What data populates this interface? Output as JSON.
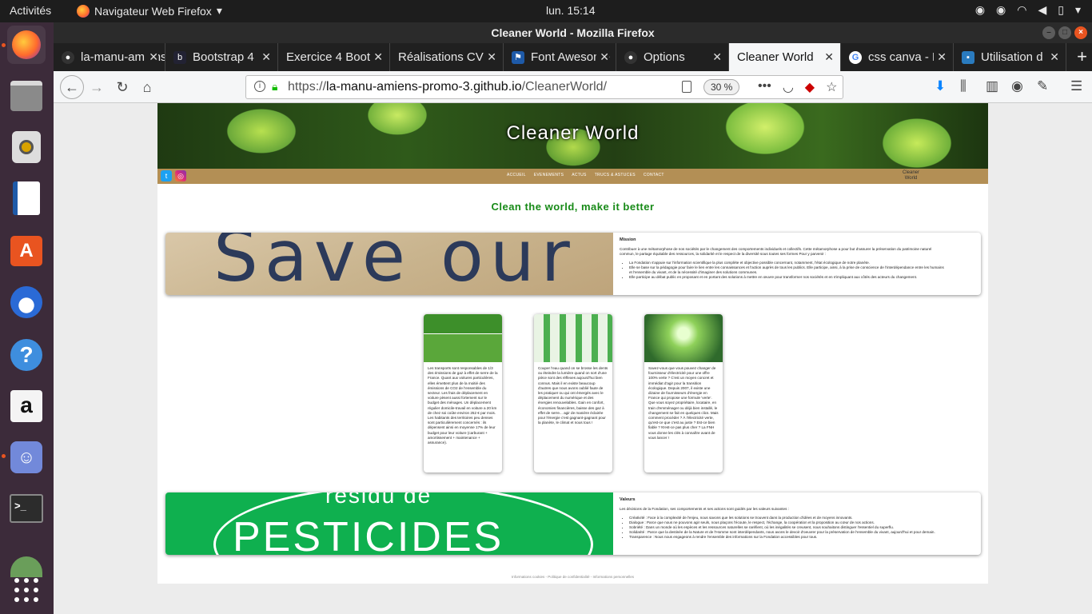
{
  "system": {
    "activities": "Activités",
    "app_name": "Navigateur Web Firefox",
    "clock": "lun. 15:14"
  },
  "window": {
    "title": "Cleaner World - Mozilla Firefox"
  },
  "tabs": [
    {
      "label": "la-manu-amiens",
      "icon": "github-icon"
    },
    {
      "label": "Bootstrap 4",
      "icon": "bootstrap-icon"
    },
    {
      "label": "Exercice 4 Boot",
      "icon": "none"
    },
    {
      "label": "Réalisations CV",
      "icon": "none"
    },
    {
      "label": "Font Awesome",
      "icon": "flag-icon"
    },
    {
      "label": "Options",
      "icon": "github-icon"
    },
    {
      "label": "Cleaner World",
      "icon": "none"
    },
    {
      "label": "css canva - R",
      "icon": "google-icon"
    },
    {
      "label": "Utilisation d",
      "icon": "page-icon"
    }
  ],
  "urlbar": {
    "url_prefix": "https://",
    "url_host": "la-manu-amiens-promo-3.github.io",
    "url_path": "/CleanerWorld/",
    "zoom": "30 %"
  },
  "site": {
    "title": "Cleaner World",
    "menu": [
      "ACCUEIL",
      "EVENEMENTS",
      "ACTUS",
      "TRUCS & ASTUCES",
      "CONTACT"
    ],
    "logo_line1": "Cleaner",
    "logo_line2": "World",
    "slogan": "Clean the world, make it better",
    "mission": {
      "heading": "Mission",
      "image_word": "Save our",
      "intro": "Contribuer à une métamorphose de nos sociétés par le changement des comportements individuels et collectifs. Cette métamorphose a pour but d'assurer la préservation du patrimoine naturel commun, le partage équitable des ressources, la solidarité et le respect de la diversité sous toutes ses formes Pour y parvenir :",
      "items": [
        "La Fondation s'appuie sur l'information scientifique la plus complète et objective possible concernant, notamment, l'état écologique de notre planète.",
        "Elle se base sur la pédagogie pour faire le lien entre les connaissances et l'action auprès de tous les publics. Elle participe, ainsi, à la prise de conscience de l'interdépendance entre les humains et l'ensemble du vivant, et de la nécessité d'imaginer des solutions communes.",
        "Elle participe au débat public en proposant et en portant des solutions à mettre en œuvre pour transformer nos sociétés et en s'impliquant aux côtés des acteurs du changement."
      ]
    },
    "cards": [
      {
        "text": "Les transports sont responsables de 1/3 des émissions de gaz à effet de serre de la France. Quant aux voitures particulières, elles émettent plus de la moitié des émissions de CO2 de l'ensemble du secteur. Les frais de déplacement en voiture pèsent aussi fortement sur le budget des ménages. Un déplacement régulier domicile-travail en voiture a 20 km de chez soi coûte environ 252 € par mois. Les habitants des territoires peu denses sont particulièrement concernés : ils dépensent ainsi en moyenne 17% de leur budget pour leur voiture (carburant + amortissement + maintenance + assurance)."
      },
      {
        "text": "Couper l'eau quand on se brosse les dents ou éteindre la lumière quand on sort d'une pièce sont des réflexes aujourd'hui bien connus. Mais il en existe beaucoup d'autres que nous avons oublié faute de les pratiquer ou qui ont émergés avec le déplacement du numérique et des énergies renouvelables. Gain en confort, économies financières, baisse des gaz à effet de serre... agir de manière éclairée pour l'énergie c'est gagnant-gagnant pour la planète, le climat et nous tous !"
      },
      {
        "text": "Savez-vous que vous pouvez changer de fournisseur d'électricité pour une offre 100% verte ? C'est un moyen concret et immédiat d'agir pour la transition écologique. Depuis 2007, il existe une dizaine de fournisseurs d'énergie en France qui propose une formule 'verte'. Que vous soyez propriétaire, locataire, en train d'emménager ou déjà bien installé, le changement se fait en quelques clics. Mais comment procéder ? À l'électricité verte, qu'est-ce que c'est au juste ? Est-ce bien fiable ? N'est-ce pas plus cher ? La FNH vous donne les clés à connaître avant de vous lancer !"
      }
    ],
    "valeurs": {
      "heading": "Valeurs",
      "image_word1": "résidu de",
      "image_word2": "PESTICIDES",
      "intro": "Les décisions de la Fondation, ses comportements et ses actions sont guidés par les valeurs suivantes :",
      "items": [
        "Créativité : Face à la complexité de l'enjeu, nous savons que les solutions se trouvent dans la production d'idées et de moyens innovants.",
        "Dialogue : Parce que nous ne pouvons agir seuls, nous plaçons l'écoute, le respect, l'échange, la coopération et la proposition au cœur de nos actions.",
        "Sobriété : Dans un monde où les espèces et les ressources naturelles se raréfient, où les inégalités se creusent, nous souhaitons distinguer l'essentiel du superflu.",
        "Solidarité : Parce que la destinée de la Nature et de l'Homme sont interdépendants, nous avons le devoir d'oeuvrer pour la préservation de l'ensemble du vivant, aujourd'hui et pour demain.",
        "Transparence : Nous nous engageons à rendre l'ensemble des informations sur la Fondation accessibles pour tous."
      ]
    },
    "footer": "Informations cookies - Politique de confidentialité - Informations personnelles"
  },
  "colors": {
    "menu_bar": "#b38f55",
    "slogan": "#178a17",
    "dock": "#3c2b3a",
    "ubuntu_accent": "#e95420"
  }
}
